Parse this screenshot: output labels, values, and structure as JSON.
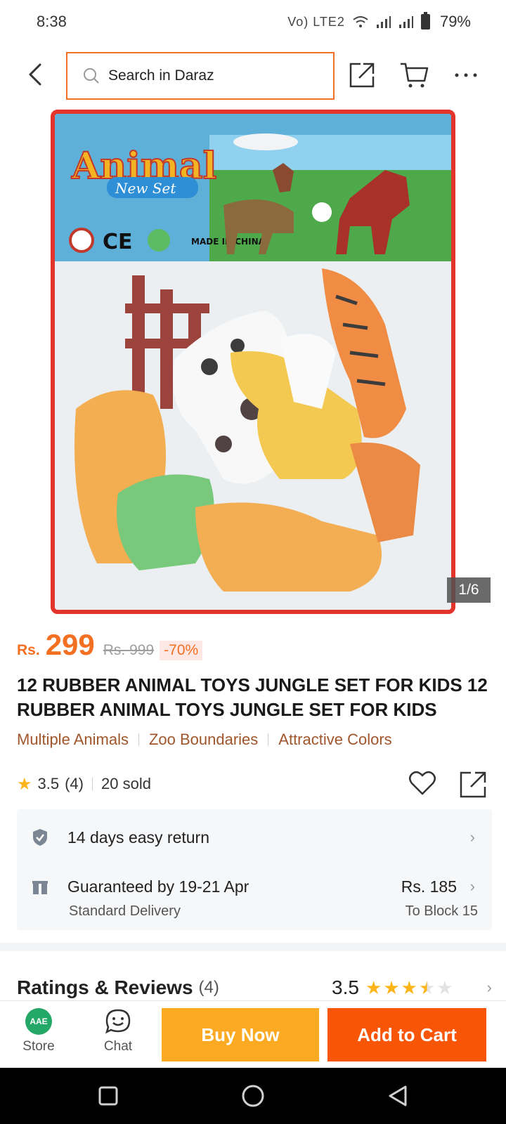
{
  "status_bar": {
    "time": "8:38",
    "network": "Vo) LTE2",
    "battery": "79%"
  },
  "top_nav": {
    "search_placeholder": "Search in Daraz"
  },
  "gallery": {
    "counter": "1/6",
    "current": 1,
    "total": 6,
    "packaging_text": [
      "Animal",
      "New Set",
      "MADE IN CHINA"
    ]
  },
  "price": {
    "currency": "Rs.",
    "current": "299",
    "original": "Rs. 999",
    "discount": "-70%"
  },
  "product": {
    "title": "12 RUBBER ANIMAL TOYS JUNGLE SET FOR KIDS 12 RUBBER ANIMAL TOYS JUNGLE SET FOR KIDS",
    "tags": [
      "Multiple Animals",
      "Zoo Boundaries",
      "Attractive Colors"
    ],
    "rating": "3.5",
    "rating_count": "(4)",
    "sold": "20 sold"
  },
  "delivery": {
    "return_text": "14 days easy return",
    "guarantee_text": "Guaranteed by 19-21 Apr",
    "fee": "Rs. 185",
    "method": "Standard Delivery",
    "destination": "To Block 15"
  },
  "reviews": {
    "title": "Ratings & Reviews",
    "count": "(4)",
    "score": "3.5",
    "stars_value": 3.5
  },
  "bottom_bar": {
    "store_label": "Store",
    "store_logo_text": "AAE",
    "chat_label": "Chat",
    "buy_now": "Buy Now",
    "add_to_cart": "Add to Cart"
  },
  "colors": {
    "accent": "#f85606",
    "price": "#f36f21",
    "buy_now": "#fcaa22",
    "tag": "#a0562c",
    "star": "#fbb51a"
  },
  "icons": [
    "back-arrow-icon",
    "search-icon",
    "share-icon",
    "cart-icon",
    "more-icon",
    "star-icon",
    "heart-icon",
    "shield-check-icon",
    "gift-box-icon",
    "chevron-right-icon",
    "chat-icon"
  ]
}
